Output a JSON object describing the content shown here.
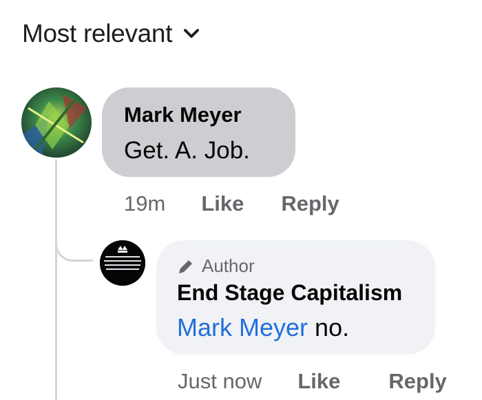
{
  "sort": {
    "label": "Most relevant",
    "icon": "chevron-down-icon"
  },
  "comment": {
    "author": "Mark Meyer",
    "text": "Get. A. Job.",
    "time": "19m",
    "like_label": "Like",
    "reply_label": "Reply"
  },
  "reply": {
    "badge": "Author",
    "badge_icon": "pencil-icon",
    "author": "End Stage Capitalism",
    "mention": "Mark Meyer",
    "text": "no.",
    "time": "Just now",
    "like_label": "Like",
    "reply_label": "Reply"
  },
  "colors": {
    "bubble_primary": "#ccced1",
    "bubble_reply": "#f0f2f5",
    "mention": "#216fdb",
    "meta_text": "#65676b"
  }
}
